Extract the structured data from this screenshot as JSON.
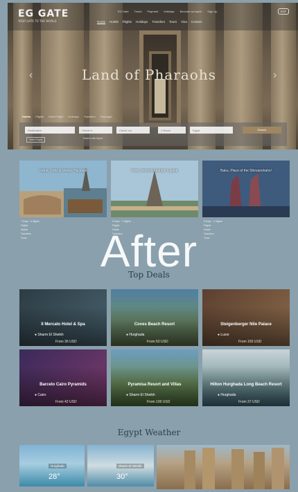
{
  "brand": {
    "name": "EG GATE",
    "tagline": "YOUR GATE TO THE WORLD"
  },
  "top_links": [
    "EG Gate",
    "Travel",
    "Payment",
    "Holidays",
    "Become an Agent",
    "Sign Up"
  ],
  "user_button": "EGP",
  "nav": [
    "Home",
    "Hotels",
    "Flights",
    "Holidays",
    "Transfers",
    "Tours",
    "Visa",
    "Contact"
  ],
  "hero": {
    "title": "Land of Pharaohs"
  },
  "search": {
    "tabs": [
      "Hotels",
      "Flights",
      "Hotel+Flight",
      "Holidays",
      "Transfers",
      "Packages"
    ],
    "destination_placeholder": "Destination",
    "checkin_placeholder": "Check in",
    "checkout_placeholder": "Check out",
    "rooms_placeholder": "1 Room",
    "nationality_placeholder": "Egypt",
    "search_label": "Search",
    "sub_button": "Hotel+Flight",
    "sub_note": "Search with flights"
  },
  "packages": [
    {
      "title": "Rome, Paris & Venice Package",
      "duration": "7 Days",
      "nights": "6 Nights",
      "features": [
        "Flights",
        "Hotels",
        "Transfers",
        "Tours"
      ]
    },
    {
      "title": "Paris, World's Fashion Capital",
      "duration": "5 Days",
      "nights": "4 Nights",
      "features": [
        "Flights",
        "Hotels",
        "Transfers",
        "Tours"
      ]
    },
    {
      "title": "Baku, Place of the Shirvanshahs!",
      "duration": "5 Days",
      "nights": "4 Nights",
      "features": [
        "Flights",
        "Hotels",
        "Transfers",
        "Tours"
      ]
    }
  ],
  "watermark": "After",
  "sections": {
    "hotels_title": "Top Deals",
    "weather_title": "Egypt Weather"
  },
  "hotels": [
    {
      "name": "Il Mercato Hotel & Spa",
      "location": "Sharm El Sheikh",
      "price": "From 36 USD"
    },
    {
      "name": "Coves Beach Resort",
      "location": "Hurghada",
      "price": "From 50 USD"
    },
    {
      "name": "Steigenberger Nile Palace",
      "location": "Luxor",
      "price": "From 150 USD"
    },
    {
      "name": "Barcelo Cairo Pyramids",
      "location": "Cairo",
      "price": "From 42 USD"
    },
    {
      "name": "Pyramisa Resort and Villas",
      "location": "Sharm El Sheikh",
      "price": "From 100 USD"
    },
    {
      "name": "Hilton Hurghada Long Beach Resort",
      "location": "Hurghada",
      "price": "From 37 USD"
    }
  ],
  "weather": [
    {
      "city": "Hurghada",
      "temp": "28°"
    },
    {
      "city": "Sharm El Sheikh",
      "temp": "30°"
    }
  ]
}
